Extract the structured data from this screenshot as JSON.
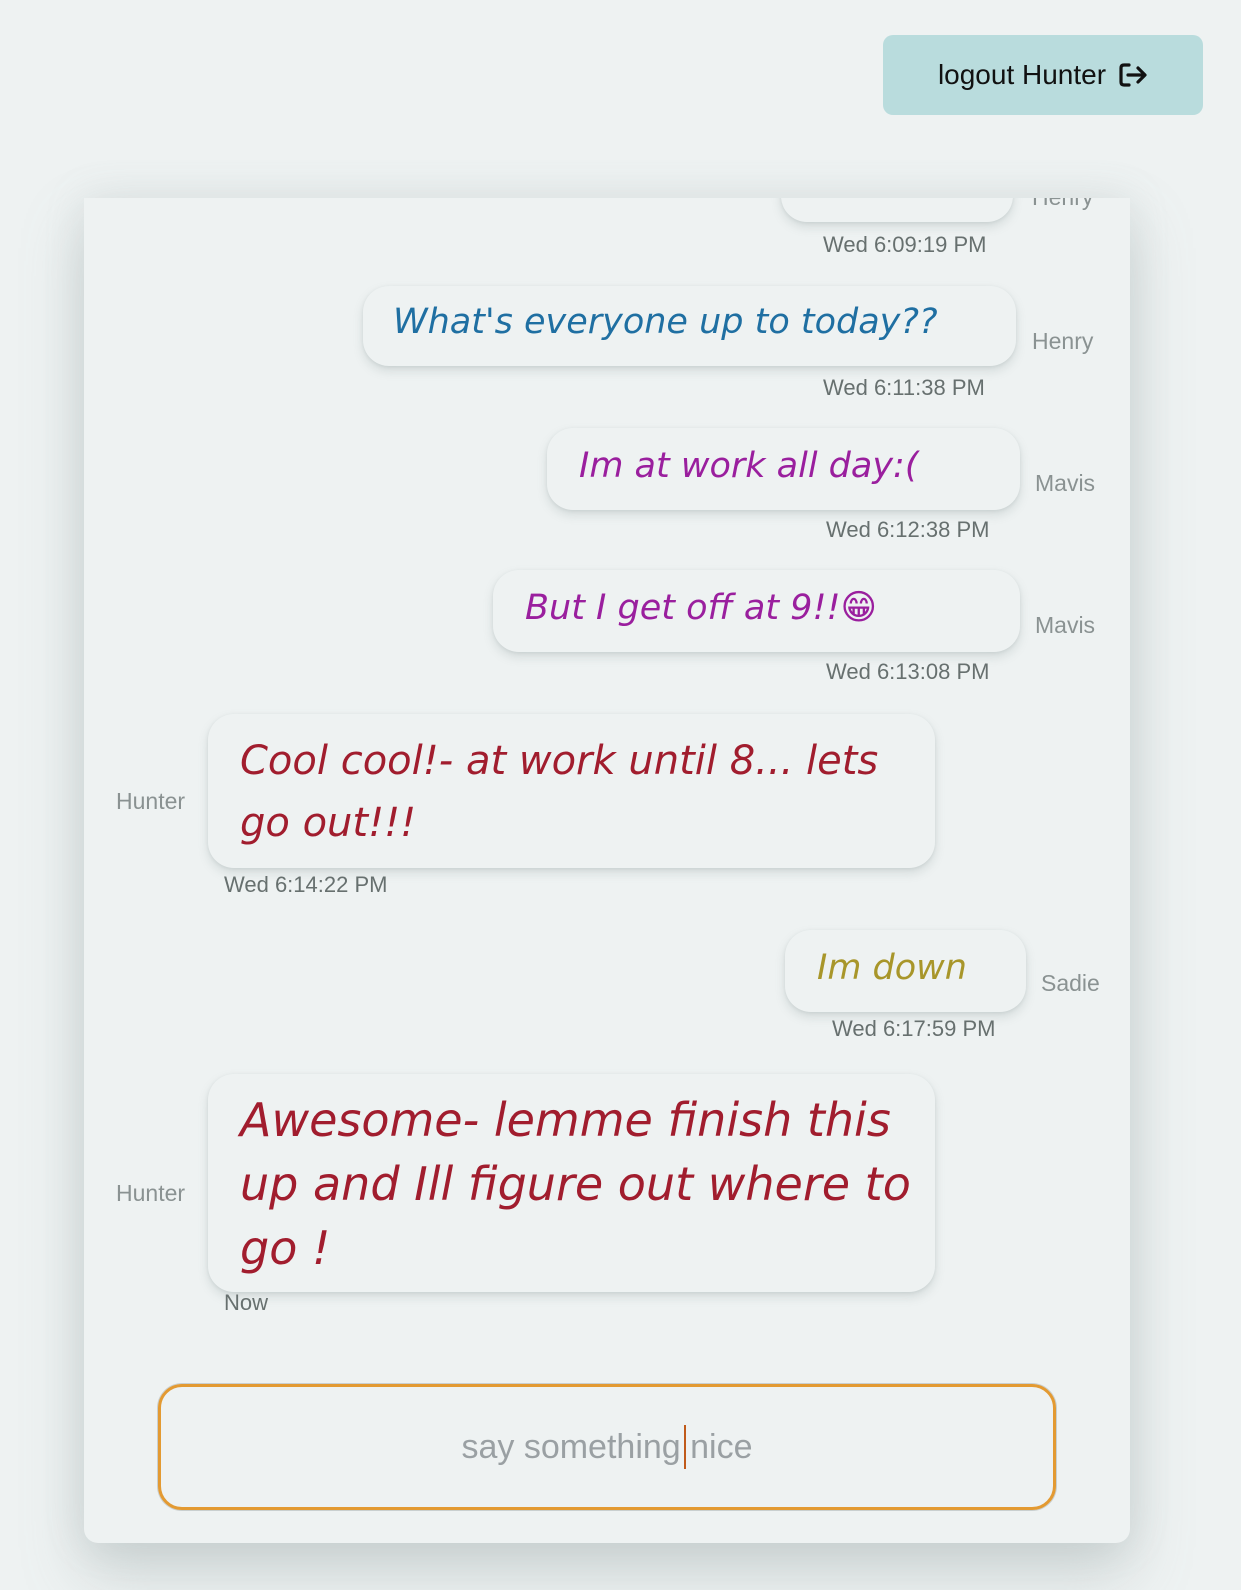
{
  "header": {
    "logout_label": "logout Hunter",
    "logout_icon": "sign-out-icon"
  },
  "messages": [
    {
      "author": "Henry",
      "text": "",
      "timestamp": "Wed 6:09:19 PM",
      "color": "#1f6fa2",
      "side": "right"
    },
    {
      "author": "Henry",
      "text": "What's everyone up to today??",
      "timestamp": "Wed 6:11:38 PM",
      "color": "#1f6fa2",
      "side": "right"
    },
    {
      "author": "Mavis",
      "text": "Im at work all day:(",
      "timestamp": "Wed 6:12:38 PM",
      "color": "#9a1f9e",
      "side": "right"
    },
    {
      "author": "Mavis",
      "text": "But I get off at 9!!😁",
      "timestamp": "Wed 6:13:08 PM",
      "color": "#9a1f9e",
      "side": "right"
    },
    {
      "author": "Hunter",
      "text": "Cool cool!- at work until 8... lets go out!!!",
      "timestamp": "Wed 6:14:22 PM",
      "color": "#a11d2e",
      "side": "left"
    },
    {
      "author": "Sadie",
      "text": "Im down",
      "timestamp": "Wed 6:17:59 PM",
      "color": "#a8962a",
      "side": "right"
    },
    {
      "author": "Hunter",
      "text": "Awesome- lemme finish this up and Ill figure out where to go !",
      "timestamp": "Now",
      "color": "#a11d2e",
      "side": "left"
    }
  ],
  "composer": {
    "placeholder": "say something nice",
    "value": ""
  },
  "colors": {
    "background": "#eef2f2",
    "logout_button": "#b9dcdd",
    "input_border": "#e39a32"
  }
}
